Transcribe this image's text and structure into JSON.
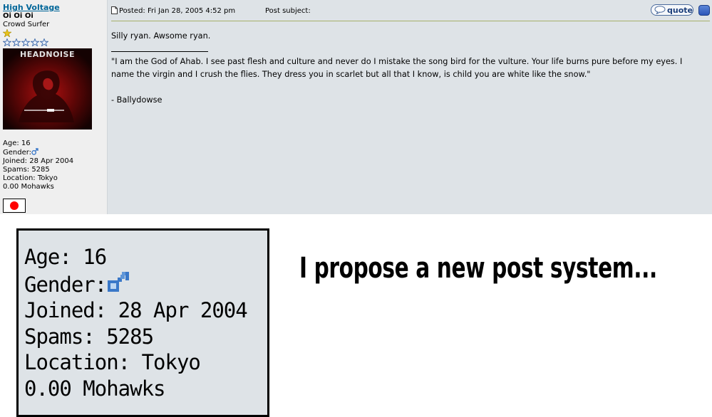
{
  "post": {
    "username": "High Voltage",
    "rank_title": "Oi Oi Oi",
    "rank_subtitle": "Crowd Surfer",
    "avatar_text": "HEADNOISE",
    "details": {
      "age": "Age: 16",
      "gender": "Gender:",
      "joined": "Joined: 28 Apr 2004",
      "spams": "Spams: 5285",
      "location": "Location: Tokyo",
      "mohawks": "0.00 Mohawks"
    },
    "header": {
      "posted": "Posted: Fri Jan 28, 2005 4:52 pm",
      "subject": "Post subject:",
      "quote_label": "quote"
    },
    "body": {
      "line1": "Silly ryan. Awsome ryan.",
      "signature_quote": "\"I am the God of Ahab. I see past flesh and culture and never do I mistake the song bird for the vulture. Your life burns pure before my eyes. I name the virgin and I crush the flies. They dress you in scarlet but all that I know, is child you are white like the snow.\"",
      "signature_author": "- Ballydowse"
    }
  },
  "zoom": {
    "age": "Age: 16",
    "gender": "Gender:",
    "joined": "Joined: 28 Apr 2004",
    "spams": "Spams: 5285",
    "location": "Location: Tokyo",
    "mohawks": "0.00 Mohawks"
  },
  "caption": "I propose a new post system...",
  "colors": {
    "post_body_bg": "#DEE3E7",
    "profile_bg": "#EFEFEF",
    "username": "#006699",
    "flag_red": "#FF0000",
    "gender_icon": "#3a78c8"
  },
  "icons": {
    "post": "post-icon",
    "gender": "male-gender-icon",
    "rank": "star-icon",
    "flag": "japan-flag-icon"
  }
}
